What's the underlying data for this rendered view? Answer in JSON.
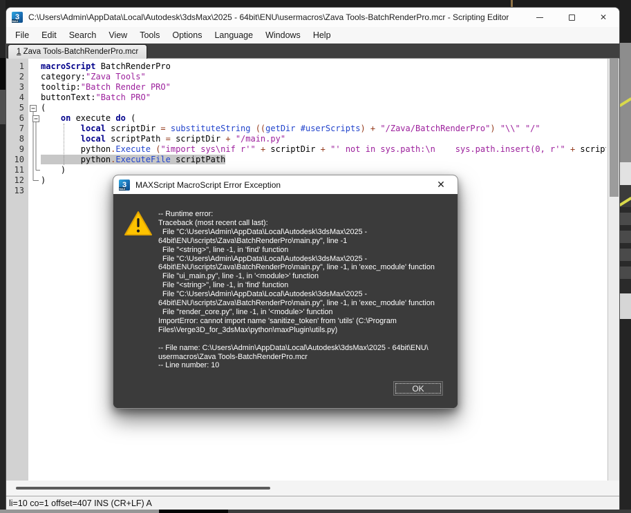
{
  "window": {
    "title": "C:\\Users\\Admin\\AppData\\Local\\Autodesk\\3dsMax\\2025 - 64bit\\ENU\\usermacros\\Zava Tools-BatchRenderPro.mcr - Scripting Editor",
    "app_icon_glyph": "3",
    "app_icon_sub": "MAX",
    "close_icon": "✕"
  },
  "menu": {
    "items": [
      "File",
      "Edit",
      "Search",
      "View",
      "Tools",
      "Options",
      "Language",
      "Windows",
      "Help"
    ]
  },
  "tab": {
    "number": "1",
    "rest": " Zava Tools-BatchRenderPro.mcr"
  },
  "editor": {
    "current_line": 10,
    "gutter": [
      "1",
      "2",
      "3",
      "4",
      "5",
      "6",
      "7",
      "8",
      "9",
      "10",
      "11",
      "12",
      "13"
    ],
    "lines": [
      {
        "n": 1,
        "segs": [
          {
            "c": "kw",
            "t": "macroScript"
          },
          {
            "c": "pl",
            "t": " BatchRenderPro"
          }
        ]
      },
      {
        "n": 2,
        "segs": [
          {
            "c": "pl",
            "t": "category:"
          },
          {
            "c": "str",
            "t": "\"Zava Tools\""
          }
        ]
      },
      {
        "n": 3,
        "segs": [
          {
            "c": "pl",
            "t": "tooltip:"
          },
          {
            "c": "str",
            "t": "\"Batch Render PRO\""
          }
        ]
      },
      {
        "n": 4,
        "segs": [
          {
            "c": "pl",
            "t": "buttonText:"
          },
          {
            "c": "str",
            "t": "\"Batch PRO\""
          }
        ]
      },
      {
        "n": 5,
        "segs": [
          {
            "c": "pl",
            "t": "("
          }
        ]
      },
      {
        "n": 6,
        "segs": [
          {
            "c": "pl",
            "t": "    "
          },
          {
            "c": "kw",
            "t": "on"
          },
          {
            "c": "pl",
            "t": " execute "
          },
          {
            "c": "kw",
            "t": "do"
          },
          {
            "c": "pl",
            "t": " ("
          }
        ]
      },
      {
        "n": 7,
        "segs": [
          {
            "c": "pl",
            "t": "        "
          },
          {
            "c": "kw",
            "t": "local"
          },
          {
            "c": "pl",
            "t": " scriptDir "
          },
          {
            "c": "op",
            "t": "="
          },
          {
            "c": "pl",
            "t": " "
          },
          {
            "c": "fn",
            "t": "substituteString"
          },
          {
            "c": "pl",
            "t": " "
          },
          {
            "c": "op",
            "t": "(("
          },
          {
            "c": "fn",
            "t": "getDir"
          },
          {
            "c": "pl",
            "t": " "
          },
          {
            "c": "fn",
            "t": "#userScripts"
          },
          {
            "c": "op",
            "t": ")"
          },
          {
            "c": "pl",
            "t": " "
          },
          {
            "c": "op",
            "t": "+"
          },
          {
            "c": "pl",
            "t": " "
          },
          {
            "c": "str",
            "t": "\"/Zava/BatchRenderPro\""
          },
          {
            "c": "op",
            "t": ")"
          },
          {
            "c": "pl",
            "t": " "
          },
          {
            "c": "str",
            "t": "\"\\\\\""
          },
          {
            "c": "pl",
            "t": " "
          },
          {
            "c": "str",
            "t": "\"/\""
          }
        ]
      },
      {
        "n": 8,
        "segs": [
          {
            "c": "pl",
            "t": "        "
          },
          {
            "c": "kw",
            "t": "local"
          },
          {
            "c": "pl",
            "t": " scriptPath "
          },
          {
            "c": "op",
            "t": "="
          },
          {
            "c": "pl",
            "t": " scriptDir "
          },
          {
            "c": "op",
            "t": "+"
          },
          {
            "c": "pl",
            "t": " "
          },
          {
            "c": "str",
            "t": "\"/main.py\""
          }
        ]
      },
      {
        "n": 9,
        "segs": [
          {
            "c": "pl",
            "t": "        python"
          },
          {
            "c": "op",
            "t": "."
          },
          {
            "c": "fn",
            "t": "Execute"
          },
          {
            "c": "pl",
            "t": " "
          },
          {
            "c": "op",
            "t": "("
          },
          {
            "c": "str",
            "t": "\"import sys\\nif r'\""
          },
          {
            "c": "pl",
            "t": " "
          },
          {
            "c": "op",
            "t": "+"
          },
          {
            "c": "pl",
            "t": " scriptDir "
          },
          {
            "c": "op",
            "t": "+"
          },
          {
            "c": "pl",
            "t": " "
          },
          {
            "c": "str",
            "t": "\"' not in sys.path:\\n    sys.path.insert(0, r'\""
          },
          {
            "c": "pl",
            "t": " "
          },
          {
            "c": "op",
            "t": "+"
          },
          {
            "c": "pl",
            "t": " scriptDir "
          },
          {
            "c": "op",
            "t": "+"
          }
        ]
      },
      {
        "n": 10,
        "segs": [
          {
            "c": "pl",
            "t": "        python"
          },
          {
            "c": "op",
            "t": "."
          },
          {
            "c": "fn",
            "t": "ExecuteFile"
          },
          {
            "c": "pl",
            "t": " scriptPath"
          }
        ]
      },
      {
        "n": 11,
        "segs": [
          {
            "c": "pl",
            "t": "    )"
          }
        ]
      },
      {
        "n": 12,
        "segs": [
          {
            "c": "pl",
            "t": ")"
          }
        ]
      },
      {
        "n": 13,
        "segs": []
      }
    ]
  },
  "statusbar": {
    "text": "li=10 co=1 offset=407 INS (CR+LF) A"
  },
  "dialog": {
    "title": "MAXScript MacroScript Error Exception",
    "close_icon": "✕",
    "app_icon_glyph": "3",
    "ok_label": "OK",
    "message_lines": [
      "-- Runtime error:",
      "Traceback (most recent call last):",
      "  File \"C:\\Users\\Admin\\AppData\\Local\\Autodesk\\3dsMax\\2025 -",
      "64bit\\ENU\\scripts\\Zava\\BatchRenderPro\\main.py\", line -1",
      "  File \"<string>\", line -1, in 'find' function",
      "  File \"C:\\Users\\Admin\\AppData\\Local\\Autodesk\\3dsMax\\2025 -",
      "64bit\\ENU\\scripts\\Zava\\BatchRenderPro\\main.py\", line -1, in 'exec_module' function",
      "  File \"ui_main.py\", line -1, in '<module>' function",
      "  File \"<string>\", line -1, in 'find' function",
      "  File \"C:\\Users\\Admin\\AppData\\Local\\Autodesk\\3dsMax\\2025 -",
      "64bit\\ENU\\scripts\\Zava\\BatchRenderPro\\main.py\", line -1, in 'exec_module' function",
      "  File \"render_core.py\", line -1, in '<module>' function",
      "ImportError: cannot import name 'sanitize_token' from 'utils' (C:\\Program",
      "Files\\Verge3D_for_3dsMax\\python\\maxPlugin\\utils.py)",
      "",
      "-- File name: C:\\Users\\Admin\\AppData\\Local\\Autodesk\\3dsMax\\2025 - 64bit\\ENU\\",
      "usermacros\\Zava Tools-BatchRenderPro.mcr",
      "-- Line number: 10"
    ]
  },
  "colors": {
    "keyword": "#00008b",
    "string": "#9c1f9c",
    "function": "#2244cc",
    "operator": "#963c1e",
    "current_line_highlight": "#c7c7c7",
    "dialog_body": "#3b3b3b",
    "warning_yellow": "#fdc300"
  }
}
